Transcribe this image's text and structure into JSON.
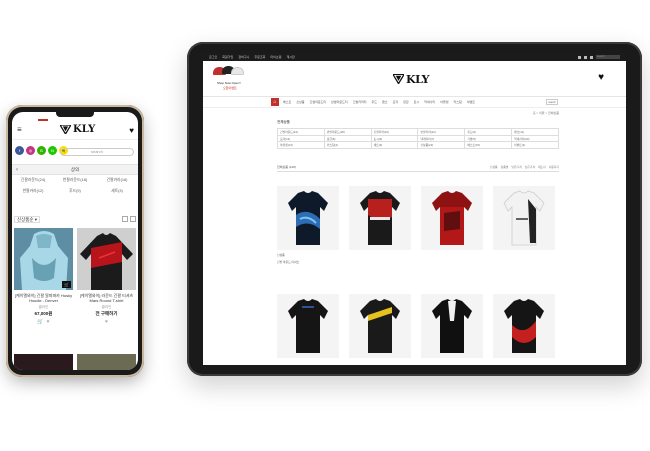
{
  "colors": {
    "brand_red": "#c0302c",
    "bezel": "#1a1a1a",
    "white": "#ffffff"
  },
  "brand": {
    "logo_text": "KLY"
  },
  "tablet": {
    "topbar": {
      "links": [
        "로그인",
        "회원가입",
        "장바구니",
        "주문조회",
        "마이쇼핑",
        "게시판"
      ],
      "search_placeholder": "search"
    },
    "promo": {
      "line1": "Shop Now Open!!",
      "line2": "오픈이벤트"
    },
    "nav_items": [
      "베스트",
      "신상품",
      "긴팔라운드티",
      "반팔라운드티",
      "긴팔카라티",
      "후드",
      "팬츠",
      "모자",
      "장갑",
      "토시",
      "악세사리",
      "아울렛",
      "커스텀",
      "이벤트"
    ],
    "nav_search": "search",
    "breadcrumb": "홈 > 의류 > 전체상품",
    "category_title": "전체상품",
    "category_items": [
      "긴팔라운드(24)",
      "반팔라운드(18)",
      "긴팔카라(16)",
      "반팔카라(12)",
      "후드(9)",
      "팬츠(11)",
      "모자(14)",
      "장갑(8)",
      "토시(6)",
      "넥게이터(7)",
      "가방(5)",
      "악세사리(20)",
      "아울렛(13)",
      "커스텀(4)",
      "세트(3)",
      "신상품(22)",
      "베스트(15)",
      "이벤트(2)"
    ],
    "sort_bar": {
      "count": "전체상품 (128)",
      "options": [
        "신상품",
        "상품명",
        "낮은가격",
        "높은가격",
        "제조사",
        "사용후기"
      ]
    },
    "products": [
      {
        "title": "신상품",
        "sub": "긴팔 라운드 티셔츠"
      },
      {
        "title": "",
        "sub": ""
      },
      {
        "title": "",
        "sub": ""
      },
      {
        "title": "",
        "sub": ""
      }
    ]
  },
  "phone": {
    "search_placeholder": "search",
    "social": [
      "f",
      "◎",
      "B",
      "N",
      "톡"
    ],
    "section_title": "상의",
    "subcategories": [
      "긴팔라운드(24)",
      "반팔라운드(18)",
      "긴팔카라(16)",
      "반팔카라(12)",
      "후드(9)",
      "세트(3)"
    ],
    "sort_label": "신상품순 ▾",
    "products": [
      {
        "name": "[케이엘와이] 긴팔 알파파카 Husky Hoodie - Denver",
        "brand": "클라인",
        "price": "67,000원"
      },
      {
        "name": "[케이엘와이] 라운드 긴팔 티셔츠 Mars Round T-shirt",
        "brand": "클라인",
        "price": "전 구매하기"
      }
    ]
  }
}
